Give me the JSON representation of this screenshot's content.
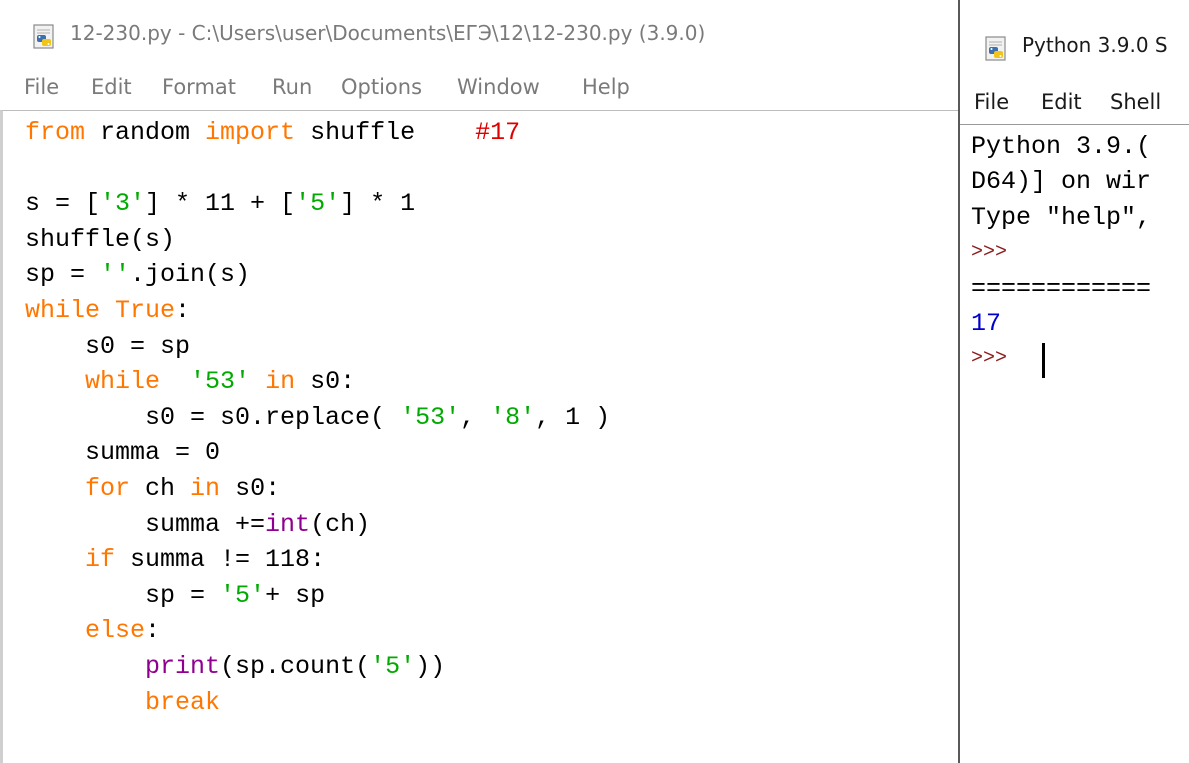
{
  "editor": {
    "title": "12-230.py - C:\\Users\\user\\Documents\\ЕГЭ\\12\\12-230.py (3.9.0)",
    "menu": [
      "File",
      "Edit",
      "Format",
      "Run",
      "Options",
      "Window",
      "Help"
    ],
    "code_lines": [
      [
        {
          "t": "from",
          "k": "kw"
        },
        {
          "t": " random ",
          "k": "pl"
        },
        {
          "t": "import",
          "k": "kw"
        },
        {
          "t": " shuffle    ",
          "k": "pl"
        },
        {
          "t": "#17",
          "k": "cm"
        }
      ],
      [],
      [
        {
          "t": "s = [",
          "k": "pl"
        },
        {
          "t": "'3'",
          "k": "st"
        },
        {
          "t": "] * 11 + [",
          "k": "pl"
        },
        {
          "t": "'5'",
          "k": "st"
        },
        {
          "t": "] * 1",
          "k": "pl"
        }
      ],
      [
        {
          "t": "shuffle(s)",
          "k": "pl"
        }
      ],
      [
        {
          "t": "sp = ",
          "k": "pl"
        },
        {
          "t": "''",
          "k": "st"
        },
        {
          "t": ".join(s)",
          "k": "pl"
        }
      ],
      [
        {
          "t": "while",
          "k": "kw"
        },
        {
          "t": " ",
          "k": "pl"
        },
        {
          "t": "True",
          "k": "kw"
        },
        {
          "t": ":",
          "k": "pl"
        }
      ],
      [
        {
          "t": "    s0 = sp",
          "k": "pl"
        }
      ],
      [
        {
          "t": "    ",
          "k": "pl"
        },
        {
          "t": "while",
          "k": "kw"
        },
        {
          "t": "  ",
          "k": "pl"
        },
        {
          "t": "'53'",
          "k": "st"
        },
        {
          "t": " ",
          "k": "pl"
        },
        {
          "t": "in",
          "k": "kw"
        },
        {
          "t": " s0:",
          "k": "pl"
        }
      ],
      [
        {
          "t": "        s0 = s0.replace( ",
          "k": "pl"
        },
        {
          "t": "'53'",
          "k": "st"
        },
        {
          "t": ", ",
          "k": "pl"
        },
        {
          "t": "'8'",
          "k": "st"
        },
        {
          "t": ", 1 )",
          "k": "pl"
        }
      ],
      [
        {
          "t": "    summa = 0",
          "k": "pl"
        }
      ],
      [
        {
          "t": "    ",
          "k": "pl"
        },
        {
          "t": "for",
          "k": "kw"
        },
        {
          "t": " ch ",
          "k": "pl"
        },
        {
          "t": "in",
          "k": "kw"
        },
        {
          "t": " s0:",
          "k": "pl"
        }
      ],
      [
        {
          "t": "        summa +=",
          "k": "pl"
        },
        {
          "t": "int",
          "k": "bi"
        },
        {
          "t": "(ch)",
          "k": "pl"
        }
      ],
      [
        {
          "t": "    ",
          "k": "pl"
        },
        {
          "t": "if",
          "k": "kw"
        },
        {
          "t": " summa != 118:",
          "k": "pl"
        }
      ],
      [
        {
          "t": "        sp = ",
          "k": "pl"
        },
        {
          "t": "'5'",
          "k": "st"
        },
        {
          "t": "+ sp",
          "k": "pl"
        }
      ],
      [
        {
          "t": "    ",
          "k": "pl"
        },
        {
          "t": "else",
          "k": "kw"
        },
        {
          "t": ":",
          "k": "pl"
        }
      ],
      [
        {
          "t": "        ",
          "k": "pl"
        },
        {
          "t": "print",
          "k": "bi"
        },
        {
          "t": "(sp.count(",
          "k": "pl"
        },
        {
          "t": "'5'",
          "k": "st"
        },
        {
          "t": "))",
          "k": "pl"
        }
      ],
      [
        {
          "t": "        ",
          "k": "pl"
        },
        {
          "t": "break",
          "k": "kw"
        }
      ]
    ]
  },
  "shell": {
    "title": "Python 3.9.0 S",
    "menu": [
      "File",
      "Edit",
      "Shell"
    ],
    "lines": [
      {
        "t": "Python 3.9.(",
        "k": "pl"
      },
      {
        "t": "D64)] on wir",
        "k": "pl"
      },
      {
        "t": "Type \"help\",",
        "k": "pl"
      },
      {
        "t": ">>>",
        "k": "prompt"
      },
      {
        "t": "============",
        "k": "pl"
      },
      {
        "t": "17",
        "k": "output"
      },
      {
        "t": ">>> ",
        "k": "prompt"
      }
    ]
  },
  "colors": {
    "keyword": "#ff7700",
    "string": "#00aa00",
    "builtin": "#900090",
    "comment": "#dd0000",
    "shell_prompt": "#8b1a1a",
    "shell_output": "#0000cc"
  },
  "icons": {
    "editor_title_icon": "python-file-icon",
    "shell_title_icon": "python-shell-icon"
  }
}
